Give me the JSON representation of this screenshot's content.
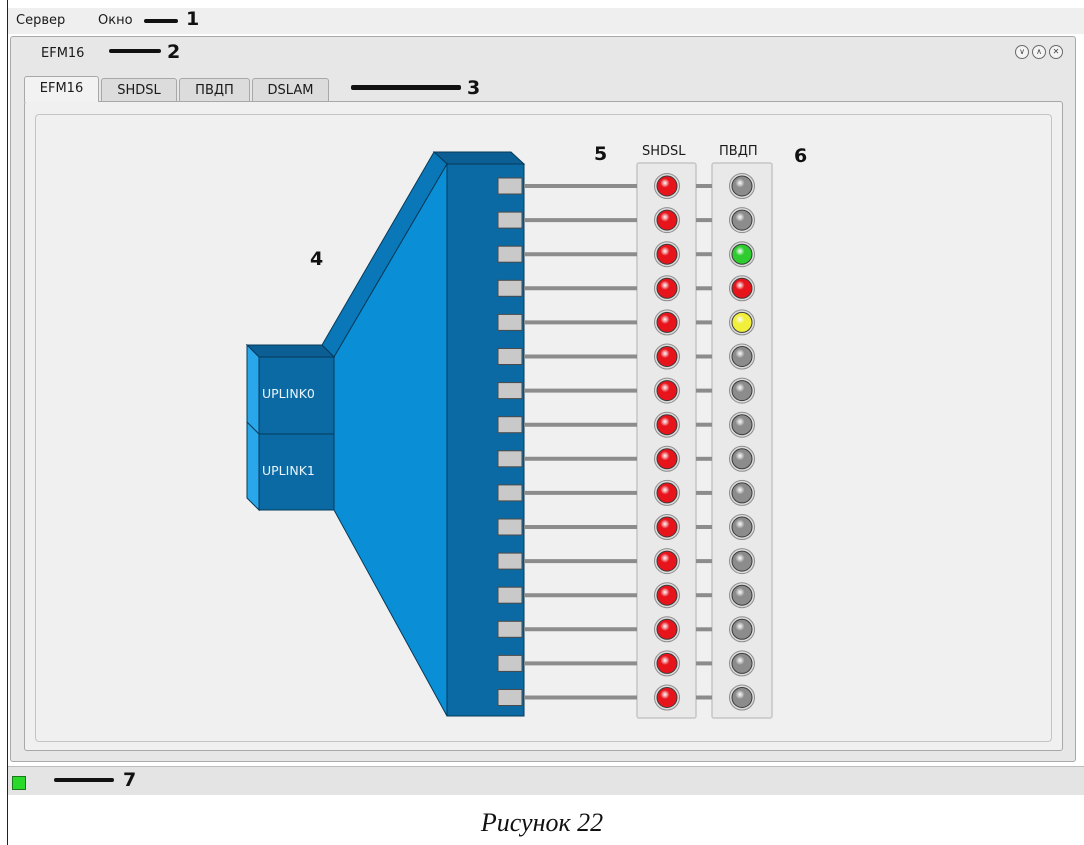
{
  "menubar": {
    "items": [
      "Сервер",
      "Окно"
    ]
  },
  "window": {
    "title": "EFM16",
    "buttons": [
      "minimize-icon",
      "maximize-icon",
      "close-icon"
    ]
  },
  "tabs": [
    {
      "label": "EFM16",
      "active": true
    },
    {
      "label": "SHDSL",
      "active": false
    },
    {
      "label": "ПВДП",
      "active": false
    },
    {
      "label": "DSLAM",
      "active": false
    }
  ],
  "device": {
    "uplinks": [
      "UPLINK0",
      "UPLINK1"
    ],
    "port_count": 16
  },
  "columns": {
    "shdsl_label": "SHDSL",
    "pvdp_label": "ПВДП"
  },
  "shdsl_leds": [
    "red",
    "red",
    "red",
    "red",
    "red",
    "red",
    "red",
    "red",
    "red",
    "red",
    "red",
    "red",
    "red",
    "red",
    "red",
    "red"
  ],
  "pvdp_leds": [
    "gray",
    "gray",
    "green",
    "red",
    "yellow",
    "gray",
    "gray",
    "gray",
    "gray",
    "gray",
    "gray",
    "gray",
    "gray",
    "gray",
    "gray",
    "gray"
  ],
  "colors": {
    "red": "#e8141c",
    "gray": "#8c8c8c",
    "green": "#2ecc2e",
    "yellow": "#f2ef3a",
    "device_blue": "#0a8fd6",
    "device_dark": "#0b6aa3",
    "status_ok": "#2bd92b"
  },
  "callouts": [
    "1",
    "2",
    "3",
    "4",
    "5",
    "6",
    "7"
  ],
  "caption": "Рисунок 22"
}
